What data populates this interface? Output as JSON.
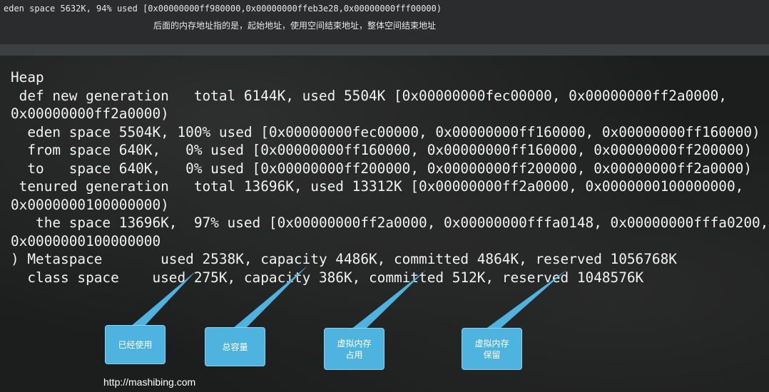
{
  "top": {
    "gc_line": "eden space 5632K, 94% used [0x00000000ff980000,0x00000000ffeb3e28,0x00000000fff00000)",
    "note": "后面的内存地址指的是，起始地址，使用空间结束地址，整体空间结束地址"
  },
  "heap": {
    "lines": [
      "Heap",
      " def new generation   total 6144K, used 5504K [0x00000000fec00000, 0x00000000ff2a0000,",
      "0x00000000ff2a0000)",
      "  eden space 5504K, 100% used [0x00000000fec00000, 0x00000000ff160000, 0x00000000ff160000)",
      "  from space 640K,   0% used [0x00000000ff160000, 0x00000000ff160000, 0x00000000ff200000)",
      "  to   space 640K,   0% used [0x00000000ff200000, 0x00000000ff200000, 0x00000000ff2a0000)",
      " tenured generation   total 13696K, used 13312K [0x00000000ff2a0000, 0x0000000100000000,",
      "0x0000000100000000)",
      "   the space 13696K,  97% used [0x00000000ff2a0000, 0x00000000fffa0148, 0x00000000fffa0200,",
      "0x0000000100000000",
      ") Metaspace       used 2538K, capacity 4486K, committed 4864K, reserved 1056768K",
      "  class space    used 275K, capacity 386K, committed 512K, reserved 1048576K"
    ]
  },
  "callouts": [
    {
      "lines": [
        "已经使用"
      ]
    },
    {
      "lines": [
        "总容量"
      ]
    },
    {
      "lines": [
        "虚拟内存",
        "占用"
      ]
    },
    {
      "lines": [
        "虚拟内存",
        "保留"
      ]
    }
  ],
  "footer": {
    "url": "http://mashibing.com"
  },
  "colors": {
    "callout": "#4fb3e0",
    "text": "#f2f2f2",
    "background": "#1c1d1d"
  }
}
